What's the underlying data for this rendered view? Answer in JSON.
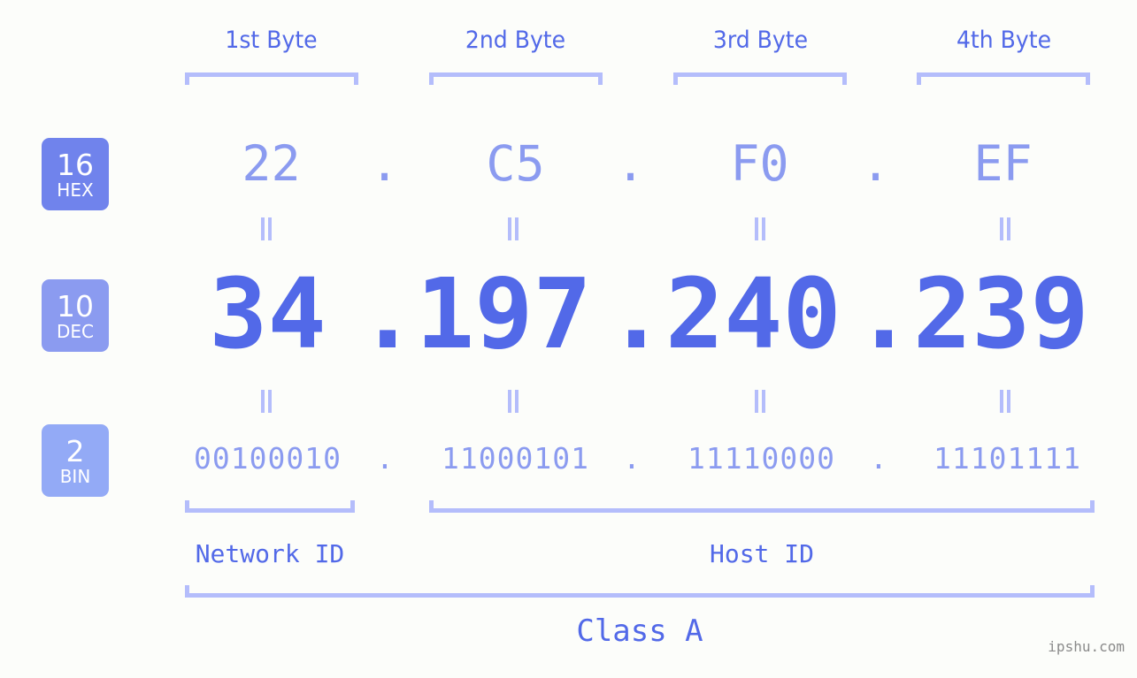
{
  "page": {
    "background": "#fcfdfa",
    "accent_strong": "#5269e8",
    "accent_light": "#8b9bf0",
    "accent_pale": "#b4bdfb",
    "watermark": "ipshu.com"
  },
  "byte_headers": [
    {
      "label": "1st Byte"
    },
    {
      "label": "2nd Byte"
    },
    {
      "label": "3rd Byte"
    },
    {
      "label": "4th Byte"
    }
  ],
  "bases": [
    {
      "number": "16",
      "name": "HEX",
      "color": "#7083ec"
    },
    {
      "number": "10",
      "name": "DEC",
      "color": "#8b9bf0"
    },
    {
      "number": "2",
      "name": "BIN",
      "color": "#93aaf6"
    }
  ],
  "rows": {
    "hex": {
      "values": [
        "22",
        "C5",
        "F0",
        "EF"
      ],
      "separator": "."
    },
    "dec": {
      "values": [
        "34",
        "197",
        "240",
        "239"
      ],
      "separator": "."
    },
    "bin": {
      "values": [
        "00100010",
        "11000101",
        "11110000",
        "11101111"
      ],
      "separator": "."
    }
  },
  "equals_symbol": "=",
  "sections": {
    "network_id": "Network ID",
    "host_id": "Host ID",
    "class": "Class A"
  }
}
